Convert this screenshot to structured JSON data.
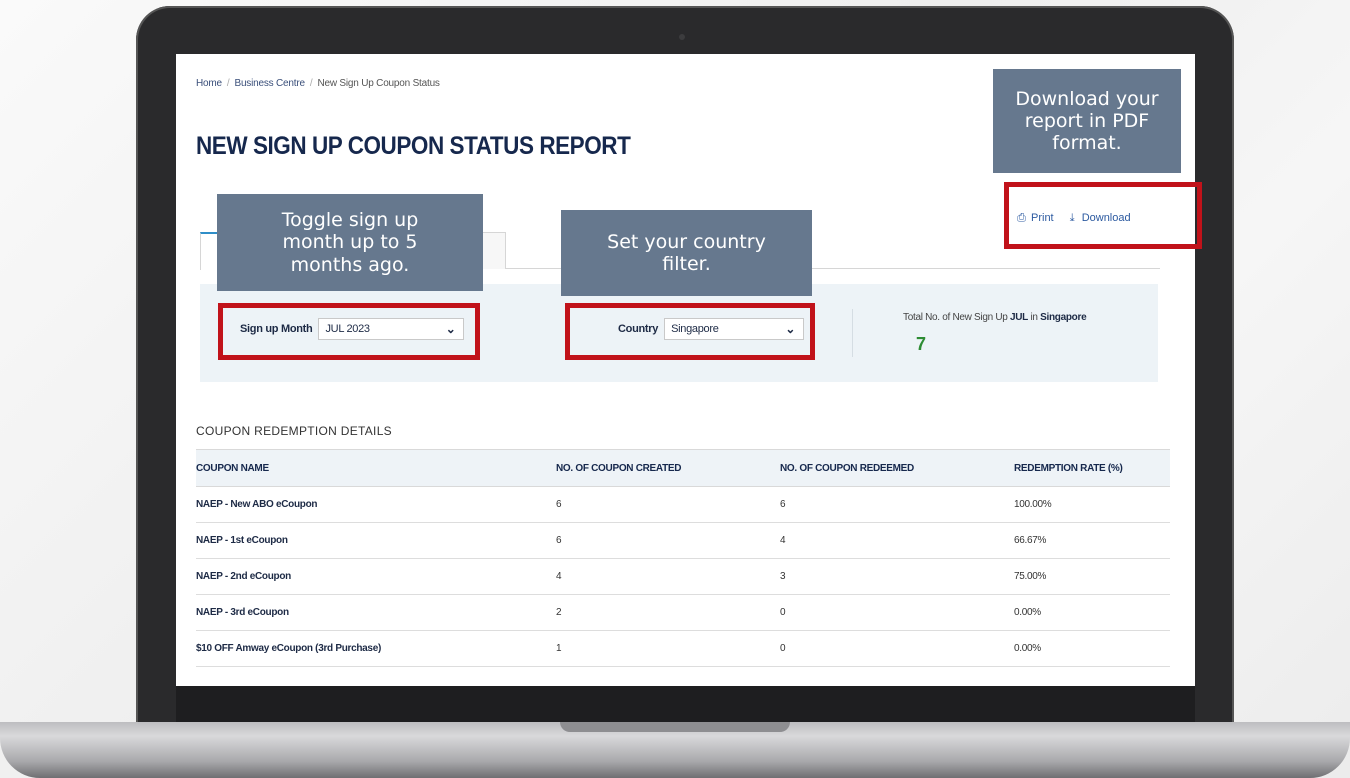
{
  "breadcrumb": {
    "home": "Home",
    "business_centre": "Business Centre",
    "current": "New Sign Up Coupon Status"
  },
  "page_title": "NEW SIGN UP COUPON STATUS REPORT",
  "actions": {
    "print": "Print",
    "download": "Download"
  },
  "filters": {
    "sign_up_month": {
      "label": "Sign up Month",
      "value": "JUL 2023"
    },
    "country": {
      "label": "Country",
      "value": "Singapore"
    }
  },
  "total": {
    "label_prefix": "Total No. of New Sign Up ",
    "month": "JUL",
    "label_mid": " in ",
    "country": "Singapore",
    "value": "7"
  },
  "section_title": "COUPON REDEMPTION DETAILS",
  "table": {
    "headers": [
      "COUPON NAME",
      "NO. OF COUPON CREATED",
      "NO. OF COUPON REDEEMED",
      "REDEMPTION RATE (%)"
    ],
    "rows": [
      [
        "NAEP - New ABO eCoupon",
        "6",
        "6",
        "100.00%"
      ],
      [
        "NAEP - 1st eCoupon",
        "6",
        "4",
        "66.67%"
      ],
      [
        "NAEP - 2nd eCoupon",
        "4",
        "3",
        "75.00%"
      ],
      [
        "NAEP - 3rd eCoupon",
        "2",
        "0",
        "0.00%"
      ],
      [
        "$10 OFF Amway eCoupon (3rd Purchase)",
        "1",
        "0",
        "0.00%"
      ]
    ]
  },
  "callouts": {
    "download": "Download your report in PDF format.",
    "month": "Toggle sign up month up to 5 months ago.",
    "country": "Set your country filter."
  },
  "colors": {
    "callout_bg": "#66788e",
    "highlight_border": "#c1121a",
    "total_value": "#2e8c34",
    "title": "#16284d"
  }
}
